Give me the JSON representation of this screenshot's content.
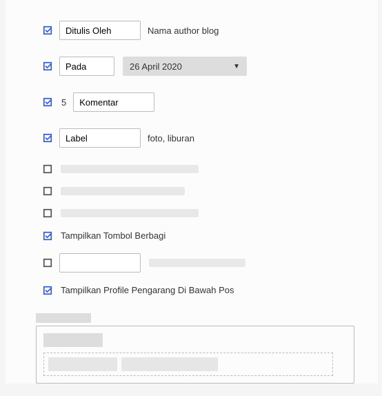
{
  "rows": {
    "author": {
      "input": "Ditulis Oleh",
      "after": "Nama author blog"
    },
    "date": {
      "input": "Pada",
      "dropdown": "26 April 2020"
    },
    "comments": {
      "count": "5",
      "input": "Komentar"
    },
    "label": {
      "input": "Label",
      "after": "foto, liburan"
    },
    "share": {
      "text": "Tampilkan Tombol Berbagi"
    },
    "profile": {
      "text": "Tampilkan Profile Pengarang Di Bawah Pos"
    }
  }
}
